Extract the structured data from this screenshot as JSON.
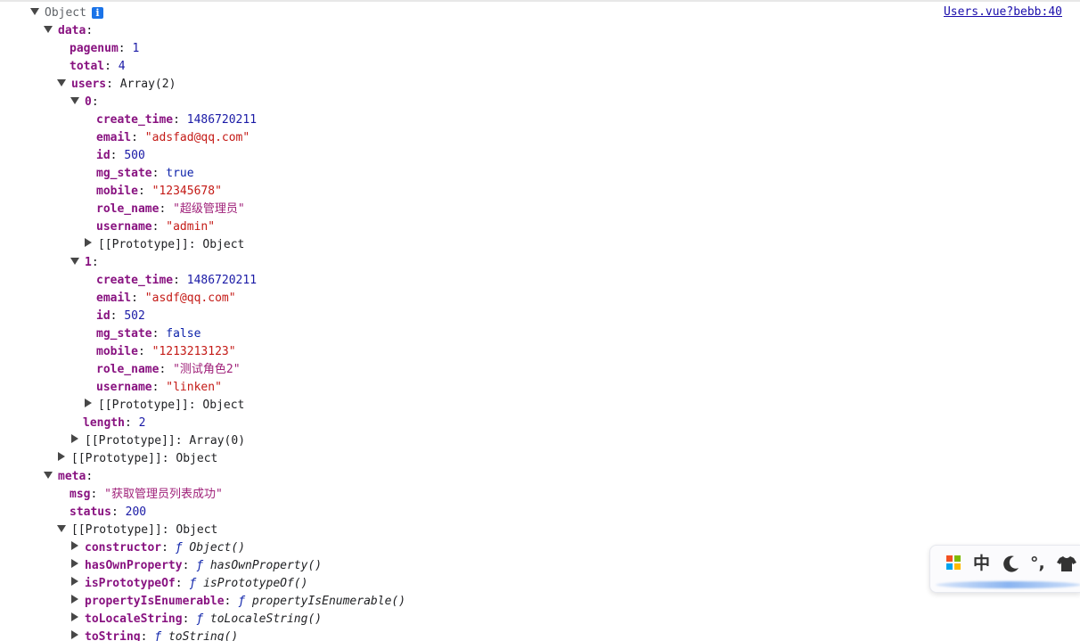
{
  "console": {
    "source_link": "Users.vue?bebb:40",
    "root_label": "Object",
    "info_icon_glyph": "i",
    "lines": [
      {
        "indent": 0,
        "toggle": "down",
        "kind": "label",
        "text": "Object",
        "info": true
      },
      {
        "indent": 1,
        "toggle": "down",
        "kind": "key",
        "key": "data"
      },
      {
        "indent": 2,
        "toggle": null,
        "kind": "kv",
        "key": "pagenum",
        "value": "1",
        "vtype": "num"
      },
      {
        "indent": 2,
        "toggle": null,
        "kind": "kv",
        "key": "total",
        "value": "4",
        "vtype": "num"
      },
      {
        "indent": 2,
        "toggle": "down",
        "kind": "kv",
        "key": "users",
        "value": "Array(2)",
        "vtype": "type"
      },
      {
        "indent": 3,
        "toggle": "down",
        "kind": "key",
        "key": "0"
      },
      {
        "indent": 4,
        "toggle": null,
        "kind": "kv",
        "key": "create_time",
        "value": "1486720211",
        "vtype": "num"
      },
      {
        "indent": 4,
        "toggle": null,
        "kind": "kv",
        "key": "email",
        "value": "\"adsfad@qq.com\"",
        "vtype": "str"
      },
      {
        "indent": 4,
        "toggle": null,
        "kind": "kv",
        "key": "id",
        "value": "500",
        "vtype": "num"
      },
      {
        "indent": 4,
        "toggle": null,
        "kind": "kv",
        "key": "mg_state",
        "value": "true",
        "vtype": "bool"
      },
      {
        "indent": 4,
        "toggle": null,
        "kind": "kv",
        "key": "mobile",
        "value": "\"12345678\"",
        "vtype": "str"
      },
      {
        "indent": 4,
        "toggle": null,
        "kind": "kv",
        "key": "role_name",
        "value": "\"超级管理员\"",
        "vtype": "str"
      },
      {
        "indent": 4,
        "toggle": null,
        "kind": "kv",
        "key": "username",
        "value": "\"admin\"",
        "vtype": "str"
      },
      {
        "indent": 4,
        "toggle": "right",
        "kind": "proto",
        "key": "[[Prototype]]",
        "value": "Object",
        "vtype": "type"
      },
      {
        "indent": 3,
        "toggle": "down",
        "kind": "key",
        "key": "1"
      },
      {
        "indent": 4,
        "toggle": null,
        "kind": "kv",
        "key": "create_time",
        "value": "1486720211",
        "vtype": "num"
      },
      {
        "indent": 4,
        "toggle": null,
        "kind": "kv",
        "key": "email",
        "value": "\"asdf@qq.com\"",
        "vtype": "str"
      },
      {
        "indent": 4,
        "toggle": null,
        "kind": "kv",
        "key": "id",
        "value": "502",
        "vtype": "num"
      },
      {
        "indent": 4,
        "toggle": null,
        "kind": "kv",
        "key": "mg_state",
        "value": "false",
        "vtype": "bool"
      },
      {
        "indent": 4,
        "toggle": null,
        "kind": "kv",
        "key": "mobile",
        "value": "\"1213213123\"",
        "vtype": "str"
      },
      {
        "indent": 4,
        "toggle": null,
        "kind": "kv",
        "key": "role_name",
        "value": "\"测试角色2\"",
        "vtype": "str"
      },
      {
        "indent": 4,
        "toggle": null,
        "kind": "kv",
        "key": "username",
        "value": "\"linken\"",
        "vtype": "str"
      },
      {
        "indent": 4,
        "toggle": "right",
        "kind": "proto",
        "key": "[[Prototype]]",
        "value": "Object",
        "vtype": "type"
      },
      {
        "indent": 3,
        "toggle": null,
        "kind": "kvplain",
        "key": "length",
        "value": "2",
        "vtype": "num"
      },
      {
        "indent": 3,
        "toggle": "right",
        "kind": "proto",
        "key": "[[Prototype]]",
        "value": "Array(0)",
        "vtype": "type"
      },
      {
        "indent": 2,
        "toggle": "right",
        "kind": "proto",
        "key": "[[Prototype]]",
        "value": "Object",
        "vtype": "type"
      },
      {
        "indent": 1,
        "toggle": "down",
        "kind": "key",
        "key": "meta"
      },
      {
        "indent": 2,
        "toggle": null,
        "kind": "kv",
        "key": "msg",
        "value": "\"获取管理员列表成功\"",
        "vtype": "str"
      },
      {
        "indent": 2,
        "toggle": null,
        "kind": "kv",
        "key": "status",
        "value": "200",
        "vtype": "num"
      },
      {
        "indent": 2,
        "toggle": "down",
        "kind": "proto",
        "key": "[[Prototype]]",
        "value": "Object",
        "vtype": "type"
      },
      {
        "indent": 3,
        "toggle": "right",
        "kind": "fn",
        "key": "constructor",
        "fname": "Object()"
      },
      {
        "indent": 3,
        "toggle": "right",
        "kind": "fn",
        "key": "hasOwnProperty",
        "fname": "hasOwnProperty()"
      },
      {
        "indent": 3,
        "toggle": "right",
        "kind": "fn",
        "key": "isPrototypeOf",
        "fname": "isPrototypeOf()"
      },
      {
        "indent": 3,
        "toggle": "right",
        "kind": "fn",
        "key": "propertyIsEnumerable",
        "fname": "propertyIsEnumerable()"
      },
      {
        "indent": 3,
        "toggle": "right",
        "kind": "fn",
        "key": "toLocaleString",
        "fname": "toLocaleString()"
      },
      {
        "indent": 3,
        "toggle": "right",
        "kind": "fn",
        "key": "toString",
        "fname": "toString()"
      }
    ]
  },
  "ime_toolbar": {
    "icon": "windows-logo-icon",
    "mode_label": "中",
    "moon_glyph": "☽",
    "punct_label": "°,",
    "skin_icon": "shirt-icon"
  },
  "colors": {
    "key": "#881280",
    "number": "#1a1aa6",
    "string": "#c41a16",
    "keyword": "#0d22aa",
    "link": "#1a0dab",
    "info_badge": "#1a73e8"
  }
}
